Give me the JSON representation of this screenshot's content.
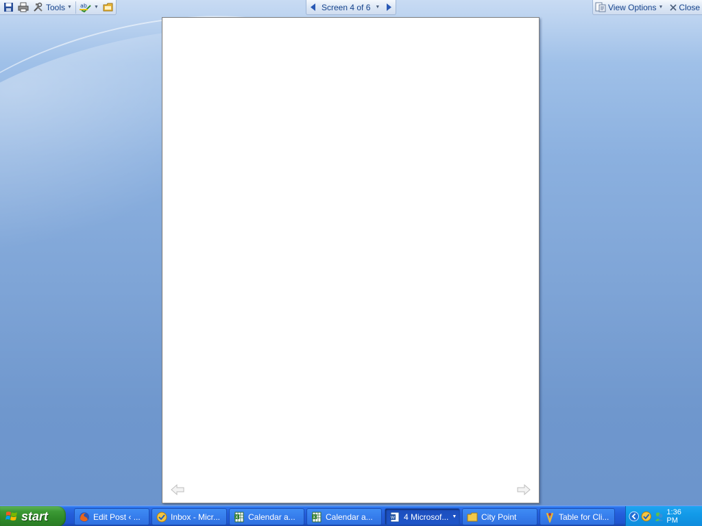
{
  "toolbar": {
    "tools_label": "Tools",
    "screen_indicator": "Screen 4 of 6",
    "view_options_label": "View Options",
    "close_label": "Close"
  },
  "taskbar": {
    "start_label": "start",
    "tasks": [
      {
        "label": "Edit Post ‹ ...",
        "icon": "firefox-icon"
      },
      {
        "label": "Inbox - Micr...",
        "icon": "outlook-icon"
      },
      {
        "label": "Calendar a...",
        "icon": "excel-icon"
      },
      {
        "label": "Calendar a...",
        "icon": "excel-icon"
      },
      {
        "label": "4 Microsof...",
        "icon": "word-icon",
        "active": true
      },
      {
        "label": "City Point",
        "icon": "folder-icon"
      },
      {
        "label": "Table for Cli...",
        "icon": "app-icon"
      }
    ],
    "clock": "1:36 PM"
  },
  "colors": {
    "toolbar_text": "#15428b",
    "taskbar_blue": "#245edb",
    "start_green": "#3c9a35",
    "tray_blue": "#129ae8"
  }
}
